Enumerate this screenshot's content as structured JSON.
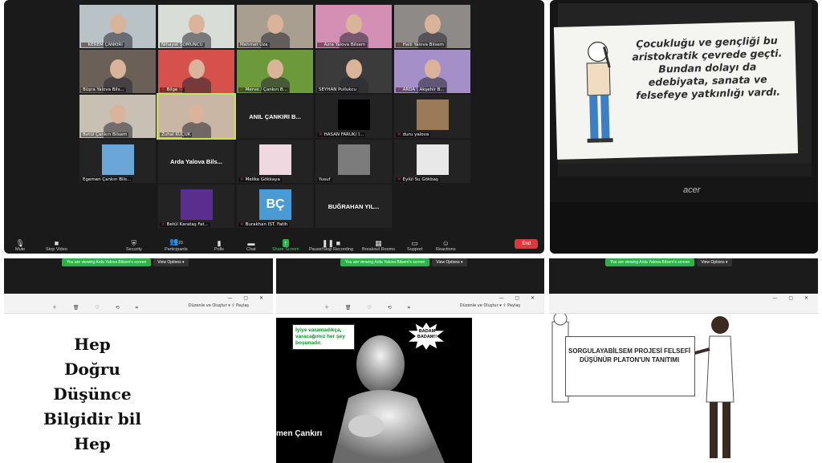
{
  "zoom": {
    "tiles": [
      {
        "label": "KEREM ÇANKIRI",
        "kind": "video",
        "bg": "#b9c2c6",
        "mic": true
      },
      {
        "label": "Nihayat ŞOMUNCU",
        "kind": "video",
        "bg": "#d9ddd8",
        "mic": false
      },
      {
        "label": "Mehmet Uza",
        "kind": "video",
        "bg": "#a89f90",
        "mic": false
      },
      {
        "label": "Azra Yalova Bilsem",
        "kind": "video",
        "bg": "#d38fb4",
        "mic": true
      },
      {
        "label": "Halil Yalova Bilsem",
        "kind": "video",
        "bg": "#8e8a87",
        "mic": true
      },
      {
        "label": "Büşra Yalova Bils...",
        "kind": "video",
        "bg": "#6b6058",
        "mic": false
      },
      {
        "label": "Bilge ♡",
        "kind": "video",
        "bg": "#d6504c",
        "mic": true
      },
      {
        "label": "Merve / Çankırı B...",
        "kind": "video",
        "bg": "#6c9a3b",
        "mic": true
      },
      {
        "label": "SEYHAN Pullukcu",
        "kind": "video",
        "bg": "#3b3b3b",
        "mic": false
      },
      {
        "label": "ARDA \\ Akşehir B...",
        "kind": "video",
        "bg": "#a58fc9",
        "mic": true
      },
      {
        "label": "Betül Çankırı Bilsem",
        "kind": "video",
        "bg": "#c8c0b2",
        "mic": false
      },
      {
        "label": "Zuhal KÜÇÜK",
        "kind": "video",
        "bg": "#c9b6a4",
        "mic": false
      },
      {
        "label": "",
        "kind": "name",
        "bg": "#232323",
        "big": "ANIL ÇANKIRI B...",
        "mic": false
      },
      {
        "label": "HASAN FARUK/ I...",
        "kind": "black",
        "bg": "#232323",
        "mic": true
      },
      {
        "label": "duru yalova",
        "kind": "pic",
        "bg": "#9b7a57",
        "mic": true
      },
      {
        "label": "Egemen Çankırı Bils...",
        "kind": "pic",
        "bg": "#6aa7d8",
        "mic": false
      },
      {
        "label": "",
        "kind": "name",
        "bg": "#232323",
        "big": "Arda Yalova Bils...",
        "mic": false
      },
      {
        "label": "Melike Gökkaya",
        "kind": "pic",
        "bg": "#f0d8e0",
        "mic": true
      },
      {
        "label": "Yusuf",
        "kind": "pic",
        "bg": "#7c7c7c",
        "mic": false
      },
      {
        "label": "Eylül Su Gökbaş",
        "kind": "pic",
        "bg": "#e8e8e8",
        "mic": true
      },
      {
        "label": "Betül Karataş Fat...",
        "kind": "pic",
        "bg": "#5a2e8c",
        "mic": true
      },
      {
        "label": "Burakhan İST. Fatih",
        "kind": "bc",
        "bg": "#4a9ad4",
        "mic": true
      },
      {
        "label": "",
        "kind": "name",
        "bg": "#232323",
        "big": "BUĞRAHAN YIL...",
        "mic": false
      }
    ],
    "bc_text": "BÇ",
    "toolbar": {
      "mute": "Mute",
      "stop_video": "Stop Video",
      "security": "Security",
      "participants": "Participants",
      "participants_count": "23",
      "polls": "Polls",
      "chat": "Chat",
      "share_screen": "Share Screen",
      "recording": "Pause/Stop Recording",
      "breakout": "Breakout Rooms",
      "support": "Support",
      "reactions": "Reactions",
      "end": "End"
    }
  },
  "laptop": {
    "slide_text": "Çocukluğu ve gençliği bu aristokratik çevrede geçti. Bundan dolayı da edebiyata, sanata ve felsefeye yatkınlığı vardı.",
    "brand": "acer"
  },
  "share": {
    "banner": "You are viewing Arda Yalova Bilsem's screen",
    "view_options": "View Options ▾",
    "browser_right": "Düzenle ve Oluştur ▾   ⇪ Paylaş"
  },
  "panel3": {
    "lines": [
      "Hep",
      "Doğru",
      "Düşünce",
      "Bilgidir bil",
      "Hep"
    ]
  },
  "panel4": {
    "bubble": "İyiye varamadıkça, varacağımız her şey boşunadır.",
    "burst": "BADAM BADAM!!",
    "name": "men Çankırı"
  },
  "panel5": {
    "board": "SORGULAYABİLSEM PROJESİ FELSEFİ DÜŞÜNÜR PLATON'UN TANITIMI"
  }
}
